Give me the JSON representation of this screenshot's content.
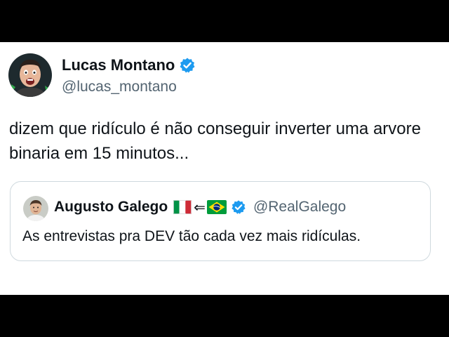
{
  "tweet": {
    "author": {
      "name": "Lucas Montano",
      "handle": "@lucas_montano",
      "verified": true
    },
    "text": "dizem que ridículo é não conseguir inverter uma arvore binaria em 15 minutos...",
    "quote": {
      "author": {
        "name": "Augusto Galego",
        "flags": [
          "flag-italy-icon",
          "arrow-left-icon",
          "flag-brazil-icon"
        ],
        "handle": "@RealGalego",
        "verified": true
      },
      "text": "As entrevistas pra DEV tão cada vez mais ridículas."
    }
  },
  "colors": {
    "text": "#0f1419",
    "secondary": "#536471",
    "verified": "#1d9bf0",
    "border": "#cfd9de",
    "letterbox": "#000000"
  }
}
